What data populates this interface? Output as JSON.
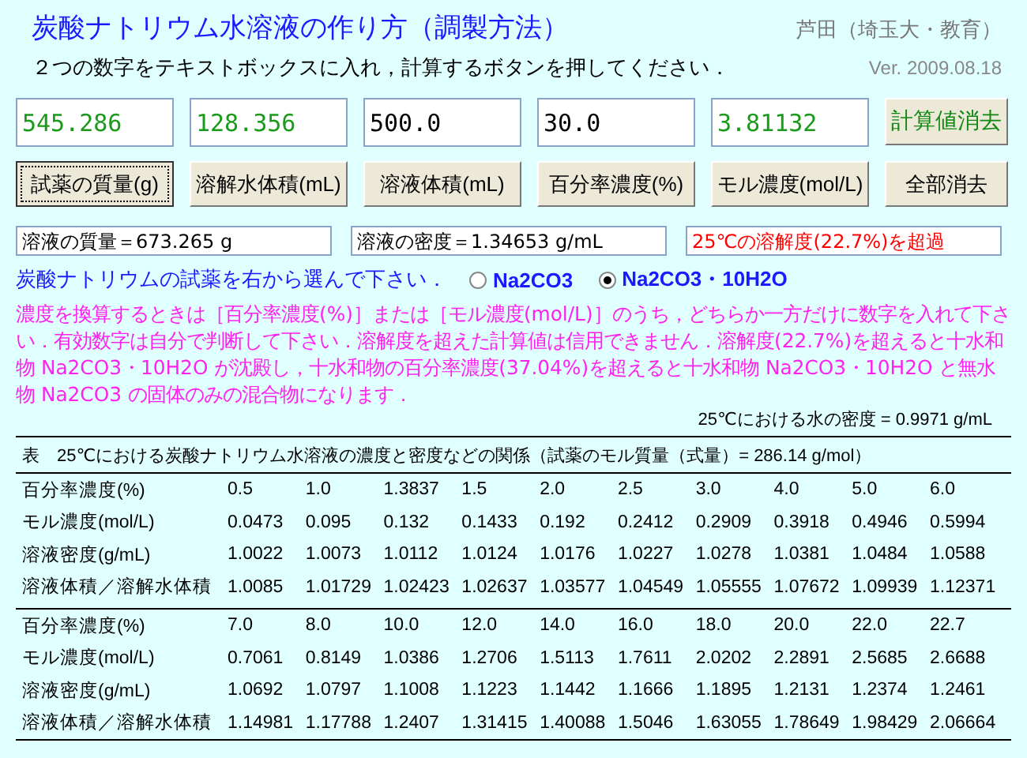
{
  "title": "炭酸ナトリウム水溶液の作り方（調製方法）",
  "author": "芦田（埼玉大・教育）",
  "instruction": "２つの数字をテキストボックスに入れ，計算するボタンを押してください．",
  "version": "Ver. 2009.08.18",
  "fields": [
    {
      "value": "545.286",
      "computed": true
    },
    {
      "value": "128.356",
      "computed": true
    },
    {
      "value": "500.0",
      "computed": false
    },
    {
      "value": "30.0",
      "computed": false
    },
    {
      "value": "3.81132",
      "computed": true
    }
  ],
  "buttons": [
    {
      "label": "計算値消去",
      "kind": "clear-computed",
      "focused": false
    },
    {
      "label": "試薬の質量(g)",
      "kind": "calc",
      "focused": true
    },
    {
      "label": "溶解水体積(mL)",
      "kind": "calc",
      "focused": false
    },
    {
      "label": "溶液体積(mL)",
      "kind": "calc",
      "focused": false
    },
    {
      "label": "百分率濃度(%)",
      "kind": "calc",
      "focused": false
    },
    {
      "label": "モル濃度(mol/L)",
      "kind": "calc",
      "focused": false
    },
    {
      "label": "全部消去",
      "kind": "clear-all",
      "focused": false
    }
  ],
  "results": [
    {
      "text": "溶液の質量＝673.265 g",
      "warning": false
    },
    {
      "text": "溶液の密度＝1.34653 g/mL",
      "warning": false
    },
    {
      "text": "25℃の溶解度(22.7%)を超過",
      "warning": true
    }
  ],
  "reagent_prompt": "炭酸ナトリウムの試薬を右から選んで下さい．",
  "reagent_options": [
    {
      "label": "Na2CO3",
      "selected": false
    },
    {
      "label": "Na2CO3・10H2O",
      "selected": true
    }
  ],
  "notice": "濃度を換算するときは［百分率濃度(%)］または［モル濃度(mol/L)］のうち，どちらか一方だけに数字を入れて下さい．有効数字は自分で判断して下さい．溶解度を超えた計算値は信用できません．溶解度(22.7%)を超えると十水和物 Na2CO3・10H2O が沈殿し，十水和物の百分率濃度(37.04%)を超えると十水和物 Na2CO3・10H2O と無水物 Na2CO3 の固体のみの混合物になります．",
  "water_density": "25℃における水の密度 = 0.9971 g/mL",
  "table": {
    "caption": "表　25℃における炭酸ナトリウム水溶液の濃度と密度などの関係（試薬のモル質量（式量）= 286.14 g/mol）",
    "blocks": [
      {
        "rows": [
          {
            "label": "百分率濃度(%)",
            "cells": [
              "0.5",
              "1.0",
              "1.3837",
              "1.5",
              "2.0",
              "2.5",
              "3.0",
              "4.0",
              "5.0",
              "6.0"
            ]
          },
          {
            "label": "モル濃度(mol/L)",
            "cells": [
              "0.0473",
              "0.095",
              "0.132",
              "0.1433",
              "0.192",
              "0.2412",
              "0.2909",
              "0.3918",
              "0.4946",
              "0.5994"
            ]
          },
          {
            "label": "溶液密度(g/mL)",
            "cells": [
              "1.0022",
              "1.0073",
              "1.0112",
              "1.0124",
              "1.0176",
              "1.0227",
              "1.0278",
              "1.0381",
              "1.0484",
              "1.0588"
            ]
          },
          {
            "label": "溶液体積／溶解水体積",
            "cells": [
              "1.0085",
              "1.01729",
              "1.02423",
              "1.02637",
              "1.03577",
              "1.04549",
              "1.05555",
              "1.07672",
              "1.09939",
              "1.12371"
            ]
          }
        ]
      },
      {
        "rows": [
          {
            "label": "百分率濃度(%)",
            "cells": [
              "7.0",
              "8.0",
              "10.0",
              "12.0",
              "14.0",
              "16.0",
              "18.0",
              "20.0",
              "22.0",
              "22.7"
            ]
          },
          {
            "label": "モル濃度(mol/L)",
            "cells": [
              "0.7061",
              "0.8149",
              "1.0386",
              "1.2706",
              "1.5113",
              "1.7611",
              "2.0202",
              "2.2891",
              "2.5685",
              "2.6688"
            ]
          },
          {
            "label": "溶液密度(g/mL)",
            "cells": [
              "1.0692",
              "1.0797",
              "1.1008",
              "1.1223",
              "1.1442",
              "1.1666",
              "1.1895",
              "1.2131",
              "1.2374",
              "1.2461"
            ]
          },
          {
            "label": "溶液体積／溶解水体積",
            "cells": [
              "1.14981",
              "1.17788",
              "1.2407",
              "1.31415",
              "1.40088",
              "1.5046",
              "1.63055",
              "1.78649",
              "1.98429",
              "2.06664"
            ]
          }
        ]
      }
    ]
  }
}
